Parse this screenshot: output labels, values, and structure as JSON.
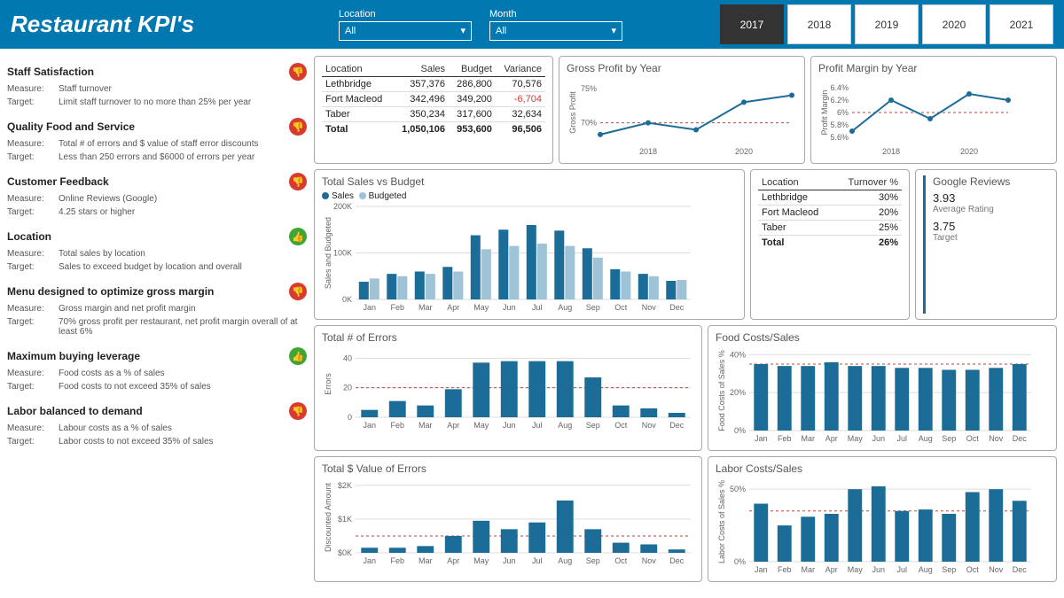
{
  "header": {
    "title": "Restaurant KPI's",
    "location_label": "Location",
    "location_value": "All",
    "month_label": "Month",
    "month_value": "All",
    "years": [
      "2017",
      "2018",
      "2019",
      "2020",
      "2021"
    ],
    "active_year": "2017"
  },
  "kpis": [
    {
      "title": "Staff Satisfaction",
      "status": "down",
      "measure": "Staff turnover",
      "target": "Limit staff turnover to no more than 25% per year"
    },
    {
      "title": "Quality Food and Service",
      "status": "down",
      "measure": "Total # of errors and $ value of staff error discounts",
      "target": "Less than 250 errors and $6000 of errors per year"
    },
    {
      "title": "Customer Feedback",
      "status": "down",
      "measure": "Online Reviews (Google)",
      "target": "4.25 stars or higher"
    },
    {
      "title": "Location",
      "status": "up",
      "measure": "Total sales by location",
      "target": "Sales to exceed budget by location and overall"
    },
    {
      "title": "Menu designed to optimize gross margin",
      "status": "down",
      "measure": "Gross margin and net profit margin",
      "target": "70% gross profit per restaurant, net profit margin overall of at least 6%"
    },
    {
      "title": "Maximum buying leverage",
      "status": "up",
      "measure": "Food costs as a % of sales",
      "target": "Food costs to not exceed 35% of sales"
    },
    {
      "title": "Labor balanced to demand",
      "status": "down",
      "measure": "Labour costs as a % of sales",
      "target": "Labor costs to not exceed 35% of sales"
    }
  ],
  "sales_table": {
    "headers": [
      "Location",
      "Sales",
      "Budget",
      "Variance"
    ],
    "rows": [
      {
        "loc": "Lethbridge",
        "sales": "357,376",
        "budget": "286,800",
        "var": "70,576",
        "neg": false
      },
      {
        "loc": "Fort Macleod",
        "sales": "342,496",
        "budget": "349,200",
        "var": "-6,704",
        "neg": true
      },
      {
        "loc": "Taber",
        "sales": "350,234",
        "budget": "317,600",
        "var": "32,634",
        "neg": false
      }
    ],
    "total": {
      "loc": "Total",
      "sales": "1,050,106",
      "budget": "953,600",
      "var": "96,506"
    }
  },
  "turnover_table": {
    "headers": [
      "Location",
      "Turnover %"
    ],
    "rows": [
      {
        "loc": "Lethbridge",
        "val": "30%"
      },
      {
        "loc": "Fort Macleod",
        "val": "20%"
      },
      {
        "loc": "Taber",
        "val": "25%"
      }
    ],
    "total": {
      "loc": "Total",
      "val": "26%"
    }
  },
  "reviews": {
    "title": "Google Reviews",
    "value": "3.93",
    "value_label": "Average Rating",
    "target": "3.75",
    "target_label": "Target"
  },
  "chart_data": {
    "gross_profit": {
      "type": "line",
      "title": "Gross Profit by Year",
      "xlabel": "",
      "ylabel": "Gross Profit",
      "x": [
        2017,
        2018,
        2019,
        2020,
        2021
      ],
      "values": [
        68.3,
        70.0,
        69.0,
        73.0,
        74.0
      ],
      "target": 70,
      "ylim": [
        67,
        76
      ],
      "yticks": [
        70,
        75
      ]
    },
    "profit_margin": {
      "type": "line",
      "title": "Profit Margin by Year",
      "xlabel": "",
      "ylabel": "Profit Margin",
      "x": [
        2017,
        2018,
        2019,
        2020,
        2021
      ],
      "values": [
        5.7,
        6.2,
        5.9,
        6.3,
        6.2
      ],
      "target": 6.0,
      "ylim": [
        5.5,
        6.5
      ],
      "yticks": [
        5.6,
        5.8,
        6.0,
        6.2,
        6.4
      ]
    },
    "sales_vs_budget": {
      "type": "bar",
      "title": "Total Sales vs Budget",
      "ylabel": "Sales and Budgeted",
      "categories": [
        "Jan",
        "Feb",
        "Mar",
        "Apr",
        "May",
        "Jun",
        "Jul",
        "Aug",
        "Sep",
        "Oct",
        "Nov",
        "Dec"
      ],
      "series": [
        {
          "name": "Sales",
          "values": [
            38,
            55,
            60,
            70,
            138,
            150,
            160,
            148,
            110,
            65,
            55,
            40
          ]
        },
        {
          "name": "Budgeted",
          "values": [
            45,
            50,
            55,
            60,
            108,
            115,
            120,
            115,
            90,
            60,
            50,
            42
          ]
        }
      ],
      "ylim": [
        0,
        200
      ],
      "yticks": [
        0,
        100,
        200
      ],
      "yunit": "K"
    },
    "errors": {
      "type": "bar",
      "title": "Total # of Errors",
      "ylabel": "Errors",
      "categories": [
        "Jan",
        "Feb",
        "Mar",
        "Apr",
        "May",
        "Jun",
        "Jul",
        "Aug",
        "Sep",
        "Oct",
        "Nov",
        "Dec"
      ],
      "values": [
        5,
        11,
        8,
        19,
        37,
        38,
        38,
        38,
        27,
        8,
        6,
        3
      ],
      "target": 20,
      "ylim": [
        0,
        45
      ],
      "yticks": [
        0,
        20,
        40
      ]
    },
    "error_value": {
      "type": "bar",
      "title": "Total $ Value of Errors",
      "ylabel": "Discounted Amount",
      "categories": [
        "Jan",
        "Feb",
        "Mar",
        "Apr",
        "May",
        "Jun",
        "Jul",
        "Aug",
        "Sep",
        "Oct",
        "Nov",
        "Dec"
      ],
      "values": [
        0.15,
        0.15,
        0.2,
        0.5,
        0.95,
        0.7,
        0.9,
        1.55,
        0.7,
        0.3,
        0.25,
        0.1
      ],
      "target": 0.5,
      "ylim": [
        0,
        2.1
      ],
      "yticks": [
        0,
        1,
        2
      ],
      "yprefix": "$",
      "yunit": "K"
    },
    "food_costs": {
      "type": "bar",
      "title": "Food Costs/Sales",
      "ylabel": "Food Costs of Sales %",
      "categories": [
        "Jan",
        "Feb",
        "Mar",
        "Apr",
        "May",
        "Jun",
        "Jul",
        "Aug",
        "Sep",
        "Oct",
        "Nov",
        "Dec"
      ],
      "values": [
        35,
        34,
        34,
        36,
        34,
        34,
        33,
        33,
        32,
        32,
        33,
        35
      ],
      "target": 35,
      "ylim": [
        0,
        42
      ],
      "yticks": [
        0,
        20,
        40
      ],
      "yunit": "%"
    },
    "labor_costs": {
      "type": "bar",
      "title": "Labor Costs/Sales",
      "ylabel": "Labor Costs of Sales %",
      "categories": [
        "Jan",
        "Feb",
        "Mar",
        "Apr",
        "May",
        "Jun",
        "Jul",
        "Aug",
        "Sep",
        "Oct",
        "Nov",
        "Dec"
      ],
      "values": [
        40,
        25,
        31,
        33,
        50,
        52,
        35,
        36,
        33,
        48,
        50,
        42
      ],
      "target": 35,
      "ylim": [
        0,
        55
      ],
      "yticks": [
        0,
        50
      ],
      "yunit": "%"
    }
  }
}
